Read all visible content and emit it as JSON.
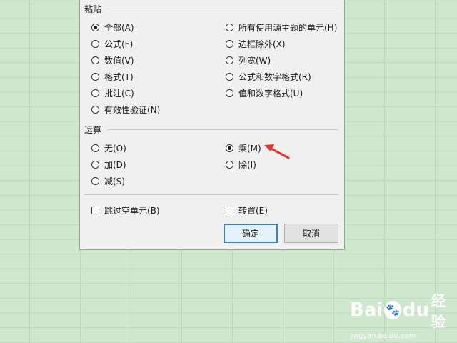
{
  "paste": {
    "label": "粘贴",
    "left": [
      {
        "label": "全部(A)",
        "checked": true
      },
      {
        "label": "公式(F)",
        "checked": false
      },
      {
        "label": "数值(V)",
        "checked": false
      },
      {
        "label": "格式(T)",
        "checked": false
      },
      {
        "label": "批注(C)",
        "checked": false
      },
      {
        "label": "有效性验证(N)",
        "checked": false
      }
    ],
    "right": [
      {
        "label": "所有使用源主题的单元(H)",
        "checked": false
      },
      {
        "label": "边框除外(X)",
        "checked": false
      },
      {
        "label": "列宽(W)",
        "checked": false
      },
      {
        "label": "公式和数字格式(R)",
        "checked": false
      },
      {
        "label": "值和数字格式(U)",
        "checked": false
      }
    ]
  },
  "operation": {
    "label": "运算",
    "left": [
      {
        "label": "无(O)",
        "checked": false
      },
      {
        "label": "加(D)",
        "checked": false
      },
      {
        "label": "减(S)",
        "checked": false
      }
    ],
    "right": [
      {
        "label": "乘(M)",
        "checked": true
      },
      {
        "label": "除(I)",
        "checked": false
      }
    ]
  },
  "options": {
    "skip_blanks": {
      "label": "跳过空单元(B)",
      "checked": false
    },
    "transpose": {
      "label": "转置(E)",
      "checked": false
    }
  },
  "buttons": {
    "ok": "确定",
    "cancel": "取消"
  },
  "watermark": {
    "brand": "Bai",
    "brand2": "du",
    "product": "经验",
    "url": "jingyan.baidu.com"
  },
  "colors": {
    "accent": "#3c7fc1",
    "arrow": "#e8332a",
    "sheet_bg": "#cfe7cf"
  }
}
